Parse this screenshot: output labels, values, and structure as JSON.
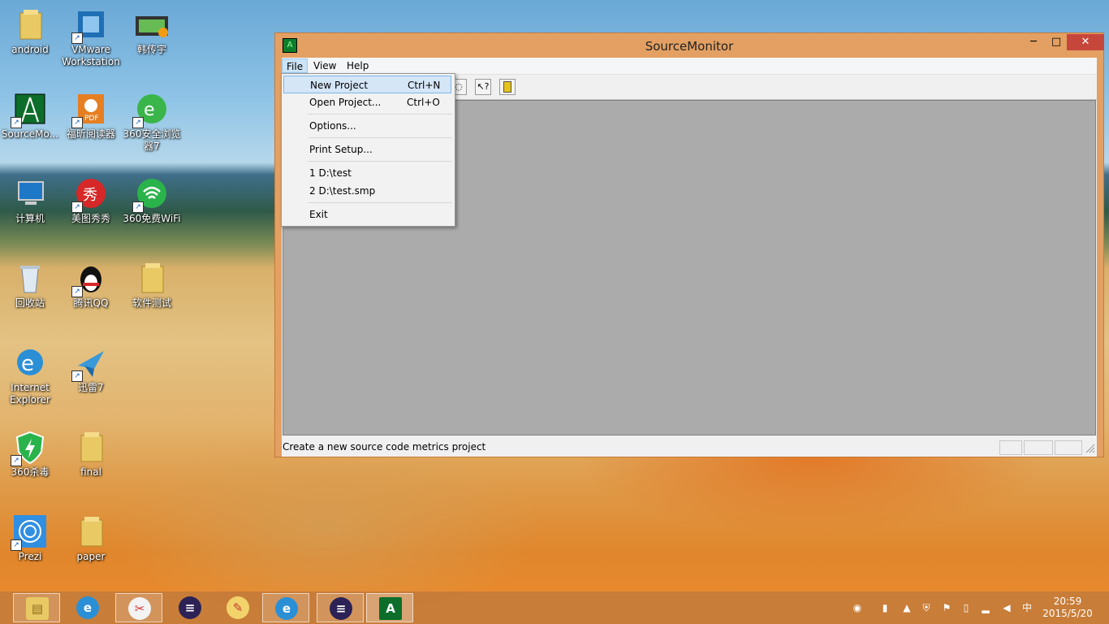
{
  "desktop": {
    "icons": [
      {
        "label": "android",
        "icon": "folder-icon"
      },
      {
        "label": "VMware Workstation",
        "icon": "vmware-icon"
      },
      {
        "label": "韩传宇",
        "icon": "video-file-icon"
      },
      {
        "label": "SourceMo...",
        "icon": "sourcemonitor-icon"
      },
      {
        "label": "福昕阅读器",
        "icon": "pdf-reader-icon"
      },
      {
        "label": "360安全浏览器7",
        "icon": "360-browser-icon"
      },
      {
        "label": "计算机",
        "icon": "computer-icon"
      },
      {
        "label": "美图秀秀",
        "icon": "meitu-icon"
      },
      {
        "label": "360免费WiFi",
        "icon": "wifi-icon"
      },
      {
        "label": "回收站",
        "icon": "recycle-bin-icon"
      },
      {
        "label": "腾讯QQ",
        "icon": "qq-icon"
      },
      {
        "label": "软件测试",
        "icon": "folder-icon"
      },
      {
        "label": "Internet Explorer",
        "icon": "ie-icon"
      },
      {
        "label": "迅雷7",
        "icon": "thunder-icon"
      },
      {
        "label": "360杀毒",
        "icon": "360-antivirus-icon"
      },
      {
        "label": "final",
        "icon": "folder-icon"
      },
      {
        "label": "Prezi",
        "icon": "prezi-icon"
      },
      {
        "label": "paper",
        "icon": "folder-icon"
      }
    ]
  },
  "window": {
    "title": "SourceMonitor",
    "controls": {
      "minimize": "─",
      "maximize": "□",
      "close": "✕"
    },
    "menu": {
      "file": "File",
      "view": "View",
      "help": "Help"
    },
    "status": "Create a new source code metrics project"
  },
  "file_menu": {
    "new_project": "New Project",
    "new_project_shortcut": "Ctrl+N",
    "open_project": "Open Project...",
    "open_project_shortcut": "Ctrl+O",
    "options": "Options...",
    "print_setup": "Print Setup...",
    "recent1": "1 D:\\test",
    "recent2": "2 D:\\test.smp",
    "exit": "Exit"
  },
  "taskbar": {
    "apps": [
      "file-explorer-icon",
      "ie-icon",
      "scissors-icon",
      "eclipse-icon",
      "paint-icon",
      "ie-icon",
      "eclipse-icon",
      "sourcemonitor-icon"
    ],
    "ime": "中",
    "time": "20:59",
    "date": "2015/5/20"
  },
  "colors": {
    "window_frame": "#e3a062",
    "close_button": "#c7463c",
    "workspace": "#ababab",
    "menu_highlight": "#d5e6f7"
  }
}
